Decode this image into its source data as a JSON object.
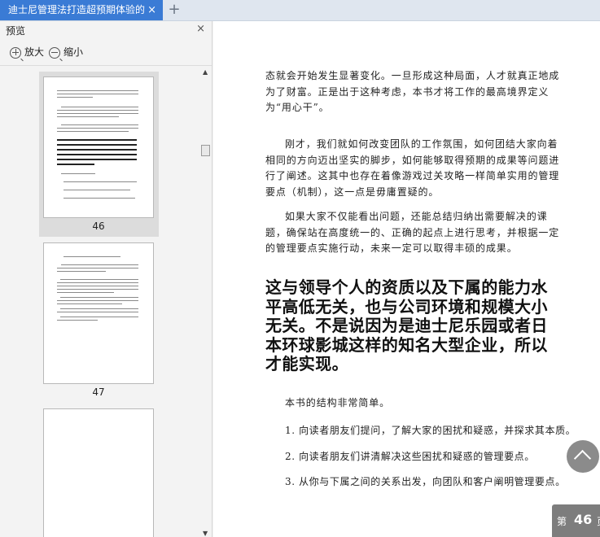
{
  "tab": {
    "title": "迪士尼管理法打造超预期体验的",
    "close": "×",
    "new_tab": "+"
  },
  "preview": {
    "title": "预览",
    "close": "×",
    "zoom_in": "放大",
    "zoom_out": "缩小",
    "pages": [
      {
        "number": "46",
        "selected": true
      },
      {
        "number": "47",
        "selected": false
      }
    ],
    "scroll_up": "▲",
    "scroll_down": "▼"
  },
  "document": {
    "para1": "态就会开始发生显著变化。一旦形成这种局面，人才就真正地成为了财富。正是出于这种考虑，本书才将工作的最高境界定义为“用心干”。",
    "para2": "刚才，我们就如何改变团队的工作氛围，如何团结大家向着相同的方向迈出坚实的脚步，如何能够取得预期的成果等问题进行了阐述。这其中也存在着像游戏过关攻略一样简单实用的管理要点（机制），这一点是毋庸置疑的。",
    "para3": "如果大家不仅能看出问题，还能总结归纳出需要解决的课题，确保站在高度统一的、正确的起点上进行思考，并根据一定的管理要点实施行动，未来一定可以取得丰硕的成果。",
    "heading": "这与领导个人的资质以及下属的能力水平高低无关，也与公司环境和规模大小无关。不是说因为是迪士尼乐园或者日本环球影城这样的知名大型企业，所以才能实现。",
    "para4": "本书的结构非常简单。",
    "items": [
      "1. 向读者朋友们提问，了解大家的困扰和疑惑，并探求其本质。",
      "2. 向读者朋友们讲清解决这些困扰和疑惑的管理要点。",
      "3. 从你与下属之间的关系出发，向团队和客户阐明管理要点。"
    ]
  },
  "page_indicator": {
    "prefix": "第",
    "number": "46",
    "suffix": "页"
  }
}
